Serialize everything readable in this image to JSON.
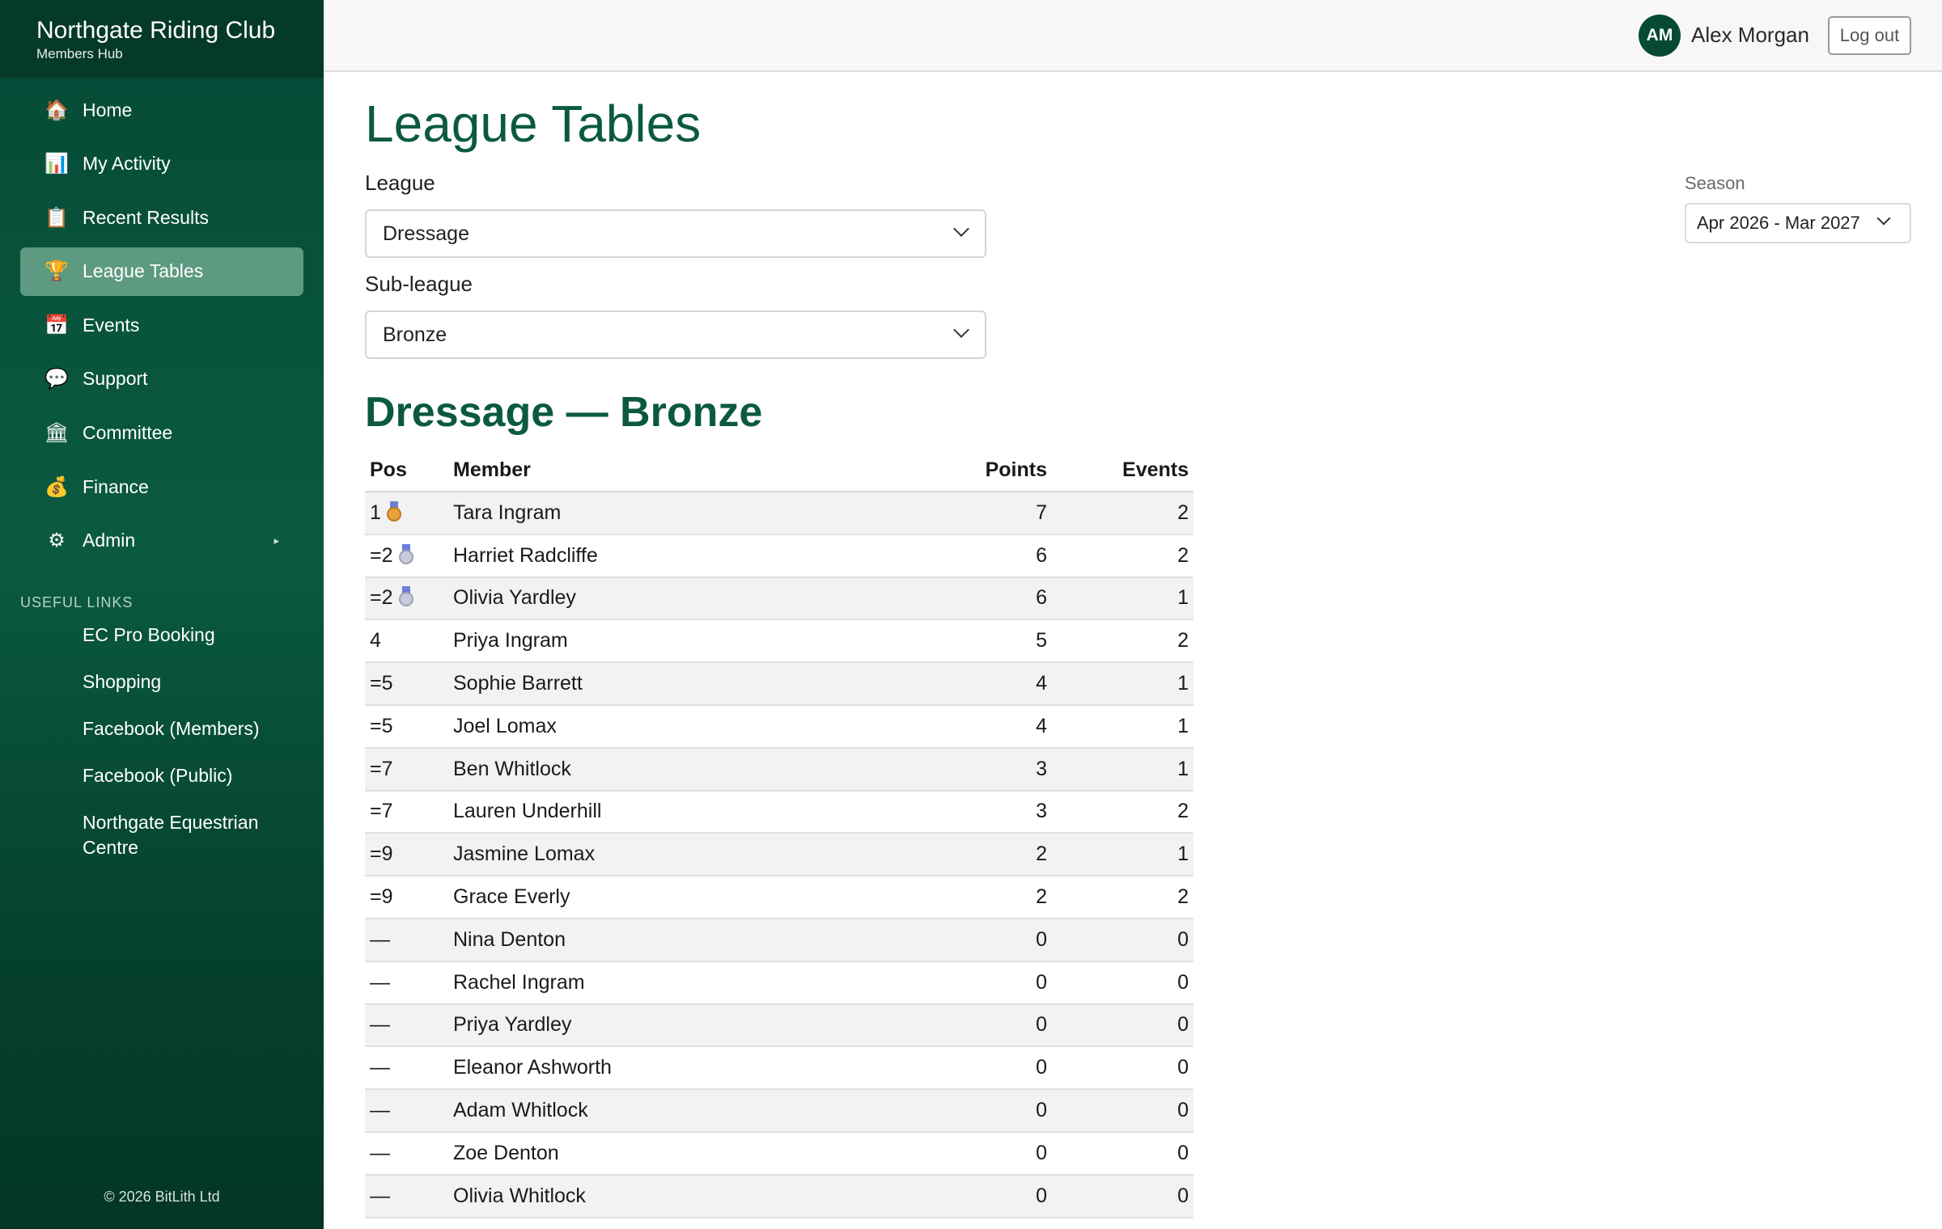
{
  "brand": {
    "title": "Northgate Riding Club",
    "subtitle": "Members Hub"
  },
  "nav": [
    {
      "label": "Home",
      "icon": "🏠",
      "icon_name": "home-icon",
      "active": false
    },
    {
      "label": "My Activity",
      "icon": "📊",
      "icon_name": "chart-icon",
      "active": false
    },
    {
      "label": "Recent Results",
      "icon": "📋",
      "icon_name": "clipboard-icon",
      "active": false
    },
    {
      "label": "League Tables",
      "icon": "🏆",
      "icon_name": "trophy-icon",
      "active": true
    },
    {
      "label": "Events",
      "icon": "📅",
      "icon_name": "calendar-icon",
      "active": false
    },
    {
      "label": "Support",
      "icon": "💬",
      "icon_name": "speech-bubble-icon",
      "active": false
    },
    {
      "label": "Committee",
      "icon": "🏛",
      "icon_name": "building-icon",
      "active": false
    },
    {
      "label": "Finance",
      "icon": "💰",
      "icon_name": "money-bag-icon",
      "active": false
    },
    {
      "label": "Admin",
      "icon": "⚙",
      "icon_name": "gear-icon",
      "active": false,
      "caret": "▸"
    }
  ],
  "useful_links": {
    "heading": "USEFUL LINKS",
    "items": [
      "EC Pro Booking",
      "Shopping",
      "Facebook (Members)",
      "Facebook (Public)",
      "Northgate Equestrian Centre"
    ]
  },
  "footer": {
    "copyright": "© 2026 BitLith Ltd"
  },
  "topbar": {
    "avatar_initials": "AM",
    "user_name": "Alex Morgan",
    "logout_label": "Log out"
  },
  "page": {
    "title": "League Tables",
    "league_label": "League",
    "league_value": "Dressage",
    "subleague_label": "Sub-league",
    "subleague_value": "Bronze",
    "season_label": "Season",
    "season_value": "Apr 2026 - Mar 2027",
    "section_title": "Dressage — Bronze"
  },
  "table": {
    "headers": {
      "pos": "Pos",
      "member": "Member",
      "points": "Points",
      "events": "Events"
    },
    "rows": [
      {
        "pos": "1",
        "medal": "gold",
        "member": "Tara Ingram",
        "points": "7",
        "events": "2"
      },
      {
        "pos": "=2",
        "medal": "silver",
        "member": "Harriet Radcliffe",
        "points": "6",
        "events": "2"
      },
      {
        "pos": "=2",
        "medal": "silver",
        "member": "Olivia Yardley",
        "points": "6",
        "events": "1"
      },
      {
        "pos": "4",
        "medal": "",
        "member": "Priya Ingram",
        "points": "5",
        "events": "2"
      },
      {
        "pos": "=5",
        "medal": "",
        "member": "Sophie Barrett",
        "points": "4",
        "events": "1"
      },
      {
        "pos": "=5",
        "medal": "",
        "member": "Joel Lomax",
        "points": "4",
        "events": "1"
      },
      {
        "pos": "=7",
        "medal": "",
        "member": "Ben Whitlock",
        "points": "3",
        "events": "1"
      },
      {
        "pos": "=7",
        "medal": "",
        "member": "Lauren Underhill",
        "points": "3",
        "events": "2"
      },
      {
        "pos": "=9",
        "medal": "",
        "member": "Jasmine Lomax",
        "points": "2",
        "events": "1"
      },
      {
        "pos": "=9",
        "medal": "",
        "member": "Grace Everly",
        "points": "2",
        "events": "2"
      },
      {
        "pos": "—",
        "medal": "",
        "member": "Nina Denton",
        "points": "0",
        "events": "0"
      },
      {
        "pos": "—",
        "medal": "",
        "member": "Rachel Ingram",
        "points": "0",
        "events": "0"
      },
      {
        "pos": "—",
        "medal": "",
        "member": "Priya Yardley",
        "points": "0",
        "events": "0"
      },
      {
        "pos": "—",
        "medal": "",
        "member": "Eleanor Ashworth",
        "points": "0",
        "events": "0"
      },
      {
        "pos": "—",
        "medal": "",
        "member": "Adam Whitlock",
        "points": "0",
        "events": "0"
      },
      {
        "pos": "—",
        "medal": "",
        "member": "Zoe Denton",
        "points": "0",
        "events": "0"
      },
      {
        "pos": "—",
        "medal": "",
        "member": "Olivia Whitlock",
        "points": "0",
        "events": "0"
      }
    ]
  }
}
